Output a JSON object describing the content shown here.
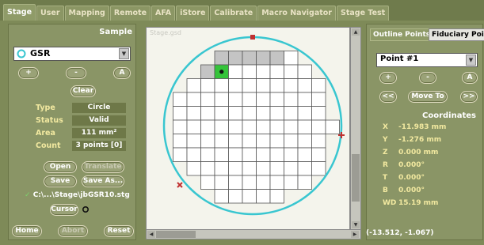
{
  "tabs": [
    "Stage",
    "User",
    "Mapping",
    "Remote",
    "AFA",
    "iStore",
    "Calibrate",
    "Macro Navigator",
    "Stage Test"
  ],
  "sample": {
    "title": "Sample",
    "selected": "GSR",
    "btn_plus": "+",
    "btn_minus": "-",
    "btn_a": "A",
    "clear_label": "Clear",
    "fields": [
      {
        "label": "Type",
        "value": "Circle"
      },
      {
        "label": "Status",
        "value": "Valid"
      },
      {
        "label": "Area",
        "value": "111 mm²"
      },
      {
        "label": "Count",
        "value": "3 points [0]"
      }
    ],
    "open_label": "Open",
    "translate_label": "Translate",
    "save_label": "Save",
    "saveas_label": "Save As...",
    "file_path": "C:\\...\\Stage\\jbGSR10.stg",
    "cursor_label": "Cursor",
    "home_label": "Home",
    "abort_label": "Abort",
    "reset_label": "Reset"
  },
  "canvas": {
    "caption": "Stage.gsd",
    "circle_color": "#39c6d0",
    "marker_color": "#c03030",
    "selected_cell_color": "#35c43a"
  },
  "outline": {
    "tab_outline": "Outline Points",
    "tab_fiducial": "Fiduciary Points",
    "point_selected": "Point #1",
    "btn_plus": "+",
    "btn_minus": "-",
    "btn_a": "A",
    "btn_prev": "<<",
    "btn_moveto": "Move To",
    "btn_next": ">>",
    "coords_title": "Coordinates",
    "coords": [
      {
        "k": "X",
        "v": "-11.983 mm"
      },
      {
        "k": "Y",
        "v": "-1.276 mm"
      },
      {
        "k": "Z",
        "v": "0.000 mm"
      },
      {
        "k": "R",
        "v": "0.000°"
      },
      {
        "k": "T",
        "v": "0.000°"
      },
      {
        "k": "B",
        "v": "0.000°"
      },
      {
        "k": "WD",
        "v": "15.19 mm"
      }
    ]
  },
  "status_coords": "(-13.512, -1.067)"
}
